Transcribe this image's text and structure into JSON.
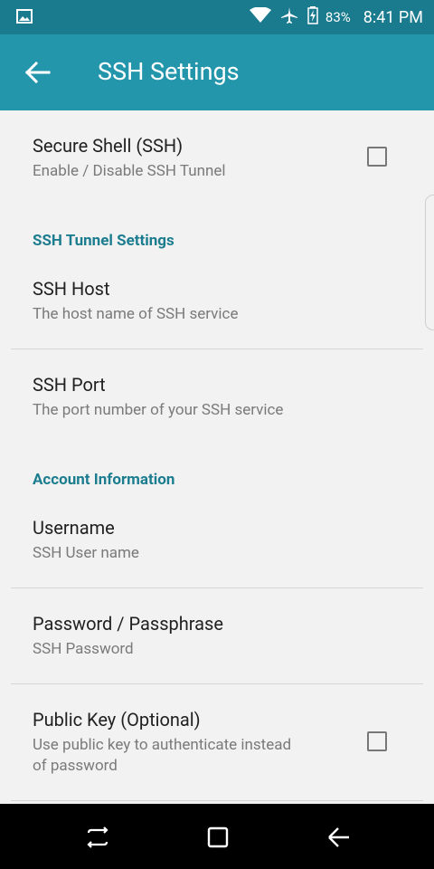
{
  "status_bar": {
    "battery": "83%",
    "time": "8:41 PM",
    "icons": [
      "image-notification-icon",
      "wifi-icon",
      "airplane-mode-icon",
      "battery-charging-icon"
    ]
  },
  "app_bar": {
    "title": "SSH Settings",
    "back_icon": "arrow-left-icon",
    "color": "#2396ac"
  },
  "prefs": {
    "ssh": {
      "title": "Secure Shell (SSH)",
      "summary": "Enable / Disable SSH Tunnel",
      "checked": false
    },
    "tunnel_category": "SSH Tunnel Settings",
    "host": {
      "title": "SSH Host",
      "summary": "The host name of SSH service"
    },
    "port": {
      "title": "SSH Port",
      "summary": "The port number of your SSH service"
    },
    "account_category": "Account Information",
    "username": {
      "title": "Username",
      "summary": "SSH User name"
    },
    "password": {
      "title": "Password / Passphrase",
      "summary": "SSH Password"
    },
    "public_key": {
      "title": "Public Key (Optional)",
      "summary_line1": "Use public key to authenticate instead",
      "summary_line2": "of password",
      "checked": false
    }
  },
  "nav_bar": {
    "buttons": [
      "recent-apps-icon",
      "home-icon",
      "back-icon"
    ]
  },
  "colors": {
    "status_bar": "#1a7a8e",
    "accent": "#1b7d8f",
    "background": "#f2f2f2"
  }
}
